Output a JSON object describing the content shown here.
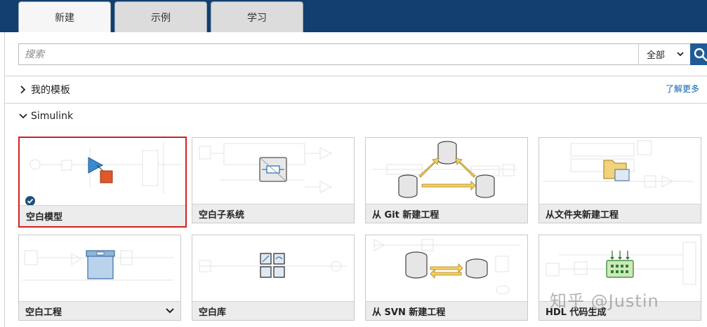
{
  "tabs": [
    {
      "label": "新建",
      "active": true
    },
    {
      "label": "示例",
      "active": false
    },
    {
      "label": "学习",
      "active": false
    }
  ],
  "search": {
    "placeholder": "搜索",
    "scope_value": "全部"
  },
  "sections": {
    "my_templates": {
      "label": "我的模板",
      "expanded": false
    },
    "learn_more": "了解更多",
    "simulink": {
      "label": "Simulink",
      "expanded": true
    }
  },
  "cards": [
    {
      "label": "空白模型",
      "selected": true,
      "icon": "blank-model-icon"
    },
    {
      "label": "空白子系统",
      "selected": false,
      "icon": "blank-subsystem-icon"
    },
    {
      "label": "从 Git 新建工程",
      "selected": false,
      "icon": "git-project-icon"
    },
    {
      "label": "从文件夹新建工程",
      "selected": false,
      "icon": "folder-project-icon"
    },
    {
      "label": "空白工程",
      "selected": false,
      "icon": "blank-project-icon",
      "has_dropdown": true
    },
    {
      "label": "空白库",
      "selected": false,
      "icon": "blank-library-icon"
    },
    {
      "label": "从 SVN 新建工程",
      "selected": false,
      "icon": "svn-project-icon"
    },
    {
      "label": "HDL 代码生成",
      "selected": false,
      "icon": "hdl-codegen-icon"
    }
  ],
  "watermark": "知乎 @Justin",
  "colors": {
    "topbar": "#123f6e",
    "selected_border": "#d42020",
    "link": "#0b63b0",
    "search_button": "#1f5b96"
  }
}
